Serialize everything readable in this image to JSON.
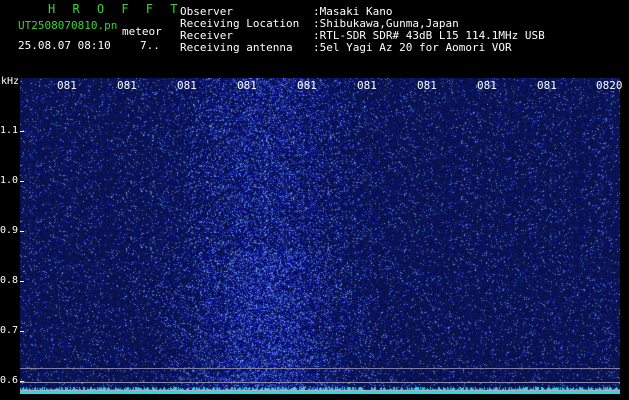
{
  "header": {
    "app_title": "H R O F F T",
    "file_name": "UT2508070810.pn",
    "subtitle": "meteor",
    "datetime": "25.08.07 08:10",
    "value": "7..",
    "info_labels": [
      "Observer",
      "Receiving Location",
      "Receiver",
      "Receiving antenna"
    ],
    "info_values": [
      ":Masaki Kano",
      ":Shibukawa,Gunma,Japan",
      ":RTL-SDR SDR# 43dB L15 114.1MHz USB",
      ":5el Yagi Az 20 for Aomori VOR"
    ]
  },
  "axes": {
    "y_unit": "kHz",
    "y_ticks": [
      "1.1",
      "1.0",
      "0.9",
      "0.8",
      "0.7",
      "0.6"
    ],
    "x_ticks": [
      "081",
      "081",
      "081",
      "081",
      "081",
      "081",
      "081",
      "081",
      "081",
      "0820"
    ]
  },
  "colors": {
    "background": "#000000",
    "noise": "#1a2a9c",
    "label_green": "#36d636",
    "baseline": "#22dddd"
  }
}
